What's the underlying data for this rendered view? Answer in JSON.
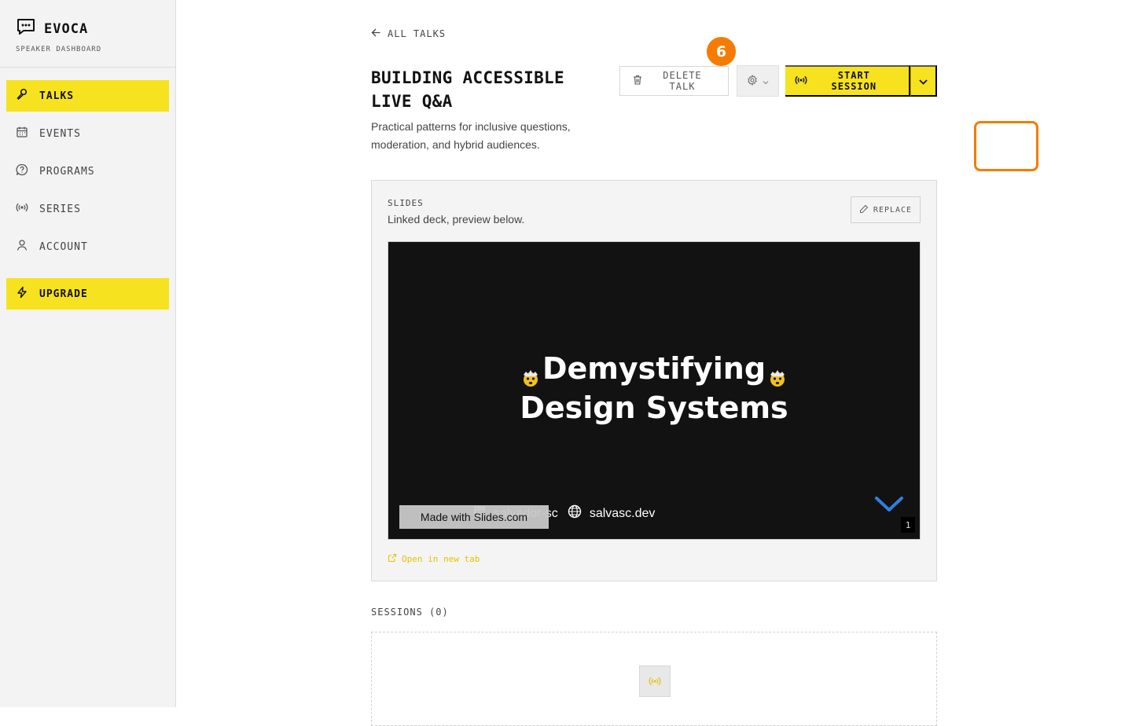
{
  "brand": {
    "name": "EVOCA",
    "subtitle": "SPEAKER DASHBOARD",
    "icon": "chat-bubble-icon"
  },
  "sidebar": {
    "items": [
      {
        "label": "TALKS",
        "icon": "microphone-icon",
        "active": true
      },
      {
        "label": "EVENTS",
        "icon": "calendar-icon",
        "active": false
      },
      {
        "label": "PROGRAMS",
        "icon": "question-bubble-icon",
        "active": false
      },
      {
        "label": "SERIES",
        "icon": "broadcast-icon",
        "active": false
      },
      {
        "label": "ACCOUNT",
        "icon": "user-icon",
        "active": false
      }
    ],
    "upgrade": {
      "label": "UPGRADE",
      "icon": "lightning-icon"
    }
  },
  "header": {
    "back_label": "ALL TALKS",
    "title": "BUILDING ACCESSIBLE LIVE Q&A",
    "subtitle": "Practical patterns for inclusive questions, moderation, and hybrid audiences."
  },
  "actions": {
    "delete_label": "DELETE TALK",
    "start_label": "START SESSION",
    "step_badge": "6"
  },
  "slides": {
    "label": "SLIDES",
    "description": "Linked deck, preview below.",
    "replace_label": "REPLACE",
    "preview": {
      "title_line1": "Demystifying",
      "title_line2": "Design Systems",
      "handle": "salvador-sc",
      "website": "salvasc.dev",
      "made_with": "Made with Slides.com",
      "page": "1"
    },
    "open_link": "Open in new tab"
  },
  "sessions": {
    "label": "SESSIONS (0)"
  },
  "colors": {
    "accent": "#f7e21f",
    "highlight": "#f57c00",
    "slide_bg": "#121212",
    "chevron": "#2f7fe0"
  }
}
